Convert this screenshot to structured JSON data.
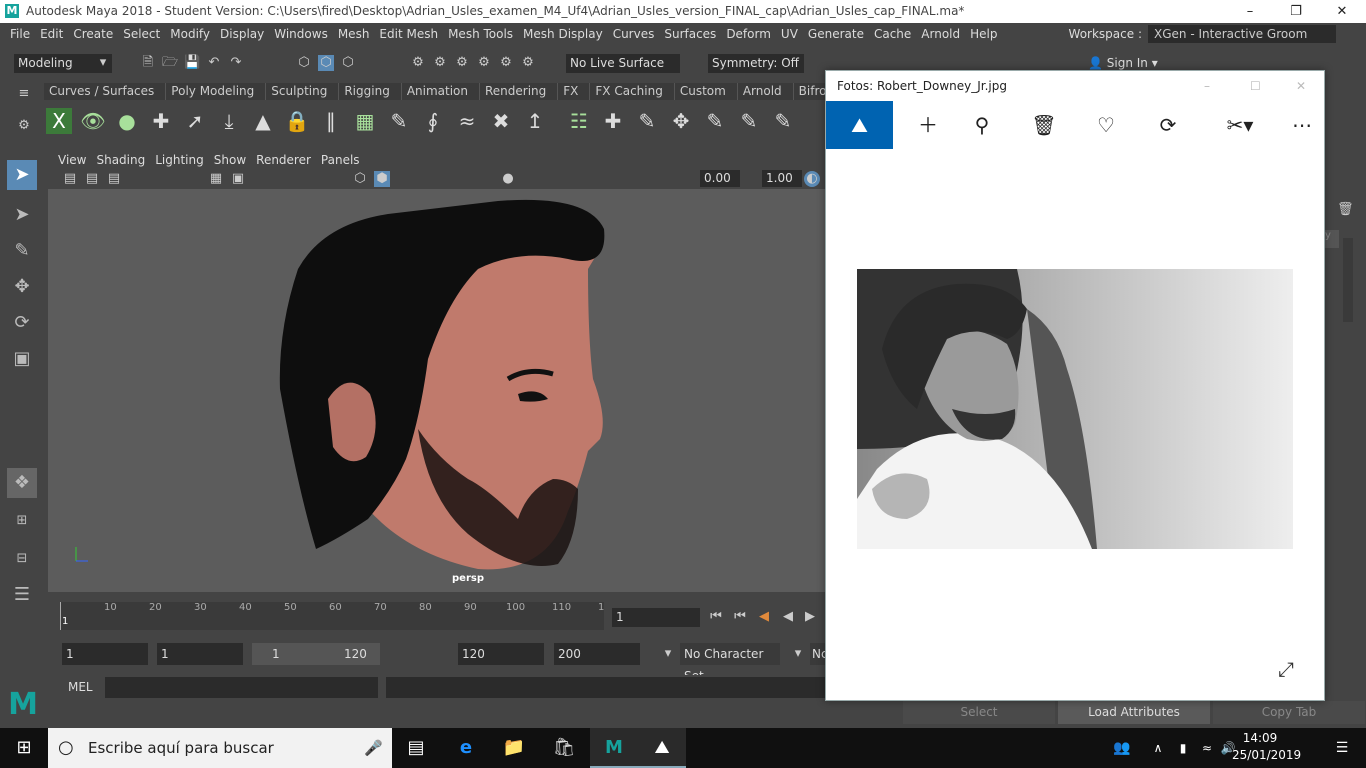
{
  "window": {
    "title": "Autodesk Maya 2018 - Student Version: C:\\Users\\fired\\Desktop\\Adrian_Usles_examen_M4_Uf4\\Adrian_Usles_version_FINAL_cap\\Adrian_Usles_cap_FINAL.ma*",
    "logo": "M"
  },
  "menu": [
    "File",
    "Edit",
    "Create",
    "Select",
    "Modify",
    "Display",
    "Windows",
    "Mesh",
    "Edit Mesh",
    "Mesh Tools",
    "Mesh Display",
    "Curves",
    "Surfaces",
    "Deform",
    "UV",
    "Generate",
    "Cache",
    "Arnold",
    "Help"
  ],
  "workspace": {
    "label": "Workspace :",
    "value": "XGen - Interactive Groom"
  },
  "status": {
    "mode": "Modeling",
    "live_surface": "No Live Surface",
    "symmetry": "Symmetry: Off",
    "sign_in": "Sign In"
  },
  "shelf_tabs": [
    "Curves / Surfaces",
    "Poly Modeling",
    "Sculpting",
    "Rigging",
    "Animation",
    "Rendering",
    "FX",
    "FX Caching",
    "Custom",
    "Arnold",
    "Bifrost"
  ],
  "panel_menu": [
    "View",
    "Shading",
    "Lighting",
    "Show",
    "Renderer",
    "Panels"
  ],
  "panel_fields": {
    "exposure": "0.00",
    "gamma": "1.00"
  },
  "viewport": {
    "camera": "persp"
  },
  "timeline": {
    "ticks": [
      "10",
      "20",
      "30",
      "40",
      "50",
      "60",
      "70",
      "80",
      "90",
      "100",
      "110",
      "1"
    ],
    "start_label": "1",
    "current_frame": "1"
  },
  "range": {
    "start": "1",
    "anim_start": "1",
    "slider_start": "1",
    "slider_end": "120",
    "anim_end": "120",
    "end": "200",
    "character_set": "No Character Set",
    "extra": "Nc"
  },
  "command": {
    "label": "MEL"
  },
  "attribute_buttons": [
    "Select",
    "Load Attributes",
    "Copy Tab"
  ],
  "photos": {
    "title": "Fotos: Robert_Downey_Jr.jpg"
  },
  "taskbar": {
    "search_placeholder": "Escribe aquí para buscar",
    "time": "14:09",
    "date": "25/01/2019"
  }
}
